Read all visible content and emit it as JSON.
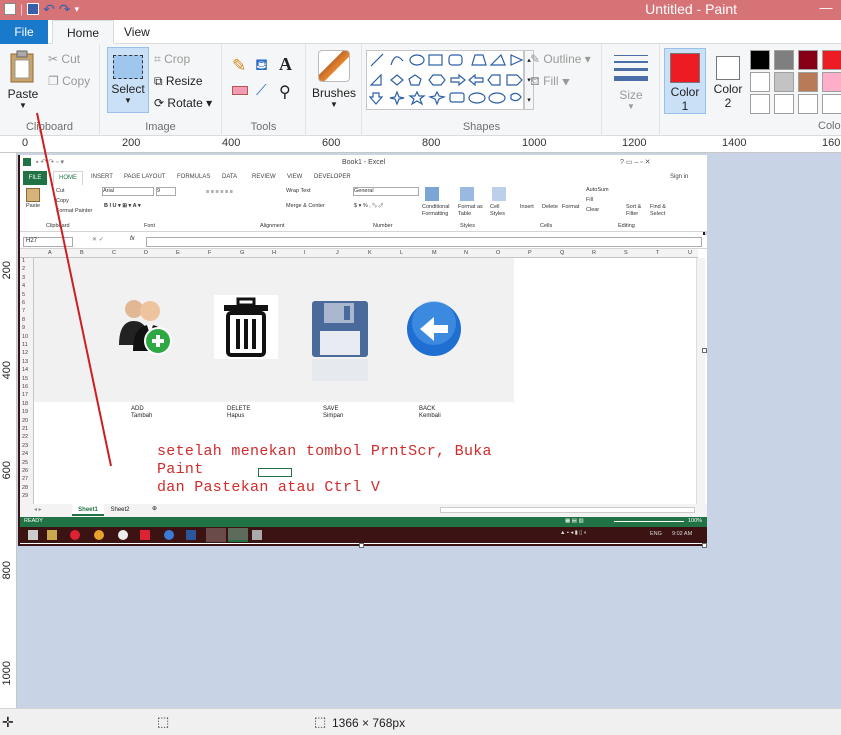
{
  "window": {
    "title": "Untitled - Paint",
    "minimize": "—"
  },
  "tabs": {
    "file": "File",
    "home": "Home",
    "view": "View"
  },
  "ribbon": {
    "clipboard": {
      "label": "Clipboard",
      "paste": "Paste",
      "cut": "Cut",
      "copy": "Copy"
    },
    "image": {
      "label": "Image",
      "select": "Select",
      "crop": "Crop",
      "resize": "Resize",
      "rotate": "Rotate"
    },
    "tools": {
      "label": "Tools"
    },
    "brushes": {
      "label": "Brushes"
    },
    "shapes": {
      "label": "Shapes",
      "outline": "Outline",
      "fill": "Fill"
    },
    "size": {
      "label": "Size"
    },
    "color1": {
      "label1": "Color",
      "label2": "1",
      "value": "#ed1c24"
    },
    "color2": {
      "label1": "Color",
      "label2": "2",
      "value": "#ffffff"
    },
    "colors_cut": "Colo",
    "palette": [
      "#000000",
      "#7f7f7f",
      "#880015",
      "#ed1c24",
      "#ffffff",
      "#c3c3c3",
      "#b97a57",
      "#ffaec9",
      "#ffffff",
      "#ffffff",
      "#ffffff",
      "#ffffff"
    ]
  },
  "ruler": {
    "top": [
      "0",
      "200",
      "400",
      "600",
      "800",
      "1000",
      "1200",
      "1400",
      "160"
    ],
    "left": [
      "200",
      "400",
      "600",
      "800",
      "1000"
    ]
  },
  "status": {
    "dimensions": "1366 × 768px"
  },
  "excel": {
    "title": "Book1 - Excel",
    "tabs": [
      "FILE",
      "HOME",
      "INSERT",
      "PAGE LAYOUT",
      "FORMULAS",
      "DATA",
      "REVIEW",
      "VIEW",
      "DEVELOPER"
    ],
    "signin": "Sign in",
    "ribbon": {
      "paste": "Paste",
      "cut": "Cut",
      "copy": "Copy",
      "format_painter": "Format Painter",
      "clipboard": "Clipboard",
      "font_name": "Arial",
      "font_size": "9",
      "font": "Font",
      "wrap_text": "Wrap Text",
      "merge_center": "Merge & Center",
      "alignment": "Alignment",
      "number_format": "General",
      "number": "Number",
      "conditional": "Conditional Formatting",
      "format_table": "Format as Table",
      "cell_styles": "Cell Styles",
      "styles": "Styles",
      "insert": "Insert",
      "delete": "Delete",
      "format": "Format",
      "cells": "Cells",
      "autosum": "AutoSum",
      "fill": "Fill",
      "clear": "Clear",
      "sort_filter": "Sort & Filter",
      "find_select": "Find & Select",
      "editing": "Editing"
    },
    "name_box": "H27",
    "fx": "fx",
    "columns": [
      "A",
      "B",
      "C",
      "D",
      "E",
      "F",
      "G",
      "H",
      "I",
      "J",
      "K",
      "L",
      "M",
      "N",
      "O",
      "P",
      "Q",
      "R",
      "S",
      "T",
      "U"
    ],
    "rows": [
      "1",
      "2",
      "3",
      "4",
      "5",
      "6",
      "7",
      "8",
      "9",
      "10",
      "11",
      "12",
      "13",
      "14",
      "15",
      "16",
      "17",
      "18",
      "19",
      "20",
      "21",
      "22",
      "23",
      "24",
      "25",
      "26",
      "27",
      "28",
      "29"
    ],
    "buttons": [
      {
        "label1": "ADD",
        "label2": "Tambah",
        "icon": "add-user-icon"
      },
      {
        "label1": "DELETE",
        "label2": "Hapus",
        "icon": "trash-icon"
      },
      {
        "label1": "SAVE",
        "label2": "Simpan",
        "icon": "floppy-disk-icon"
      },
      {
        "label1": "BACK",
        "label2": "Kembali",
        "icon": "back-arrow-icon"
      }
    ],
    "sheets": [
      "Sheet1",
      "Sheet2"
    ],
    "status_ready": "READY",
    "zoom": "100%",
    "taskbar_lang": "ENG",
    "taskbar_time": "9:02 AM"
  },
  "annotation": {
    "line1": "setelah menekan tombol PrntScr, Buka",
    "line2": "Paint",
    "line3": "dan Pastekan atau Ctrl V"
  }
}
